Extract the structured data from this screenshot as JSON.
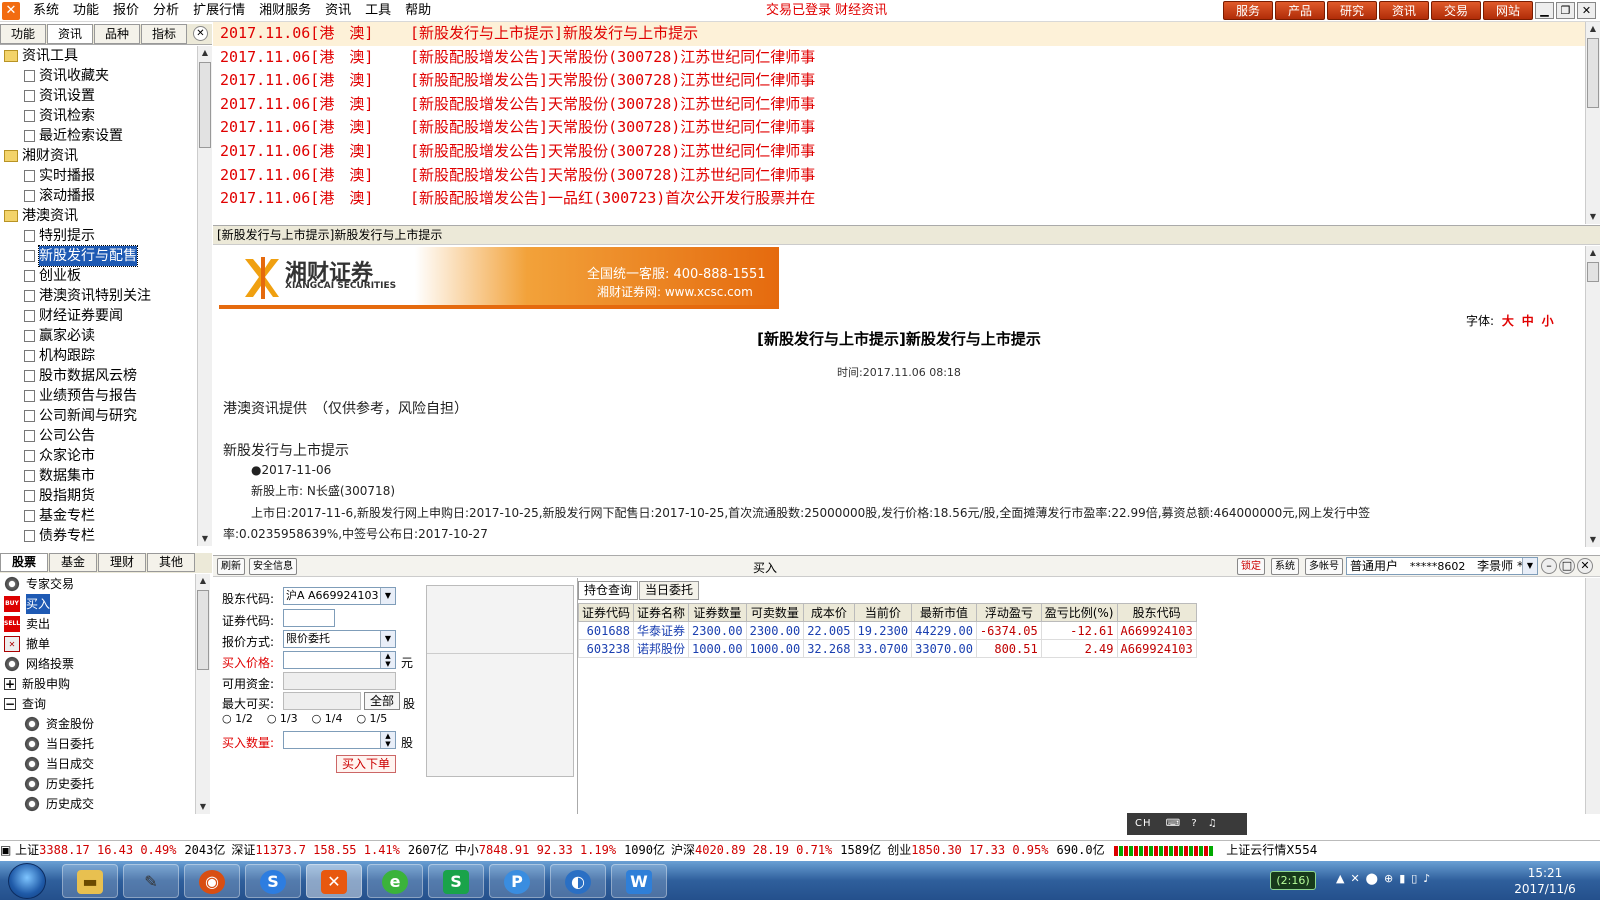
{
  "menubar": {
    "items": [
      "系统",
      "功能",
      "报价",
      "分析",
      "扩展行情",
      "湘财服务",
      "资讯",
      "工具",
      "帮助"
    ],
    "status": "交易已登录 财经资讯",
    "right_buttons": [
      "服务",
      "产品",
      "研究",
      "资讯",
      "交易",
      "网站"
    ]
  },
  "left_panel": {
    "tabs": [
      "功能",
      "资讯",
      "品种",
      "指标"
    ],
    "tree": [
      {
        "label": "资讯工具",
        "level": 1,
        "type": "folder"
      },
      {
        "label": "资讯收藏夹",
        "level": 2,
        "type": "doc"
      },
      {
        "label": "资讯设置",
        "level": 2,
        "type": "doc"
      },
      {
        "label": "资讯检索",
        "level": 2,
        "type": "doc"
      },
      {
        "label": "最近检索设置",
        "level": 2,
        "type": "doc"
      },
      {
        "label": "湘财资讯",
        "level": 1,
        "type": "folder"
      },
      {
        "label": "实时播报",
        "level": 2,
        "type": "doc"
      },
      {
        "label": "滚动播报",
        "level": 2,
        "type": "doc"
      },
      {
        "label": "港澳资讯",
        "level": 1,
        "type": "folder"
      },
      {
        "label": "特别提示",
        "level": 2,
        "type": "doc"
      },
      {
        "label": "新股发行与配售",
        "level": 2,
        "type": "doc",
        "selected": true
      },
      {
        "label": "创业板",
        "level": 2,
        "type": "doc"
      },
      {
        "label": "港澳资讯特别关注",
        "level": 2,
        "type": "doc"
      },
      {
        "label": "财经证券要闻",
        "level": 2,
        "type": "doc"
      },
      {
        "label": "赢家必读",
        "level": 2,
        "type": "doc"
      },
      {
        "label": "机构跟踪",
        "level": 2,
        "type": "doc"
      },
      {
        "label": "股市数据风云榜",
        "level": 2,
        "type": "doc"
      },
      {
        "label": "业绩预告与报告",
        "level": 2,
        "type": "doc"
      },
      {
        "label": "公司新闻与研究",
        "level": 2,
        "type": "doc"
      },
      {
        "label": "公司公告",
        "level": 2,
        "type": "doc"
      },
      {
        "label": "众家论市",
        "level": 2,
        "type": "doc"
      },
      {
        "label": "数据集市",
        "level": 2,
        "type": "doc"
      },
      {
        "label": "股指期货",
        "level": 2,
        "type": "doc"
      },
      {
        "label": "基金专栏",
        "level": 2,
        "type": "doc"
      },
      {
        "label": "债券专栏",
        "level": 2,
        "type": "doc"
      }
    ]
  },
  "news": [
    {
      "date": "2017.11.06[港　澳]",
      "title": "[新股发行与上市提示]新股发行与上市提示"
    },
    {
      "date": "2017.11.06[港　澳]",
      "title": "[新股配股增发公告]天常股份(300728)江苏世纪同仁律师事"
    },
    {
      "date": "2017.11.06[港　澳]",
      "title": "[新股配股增发公告]天常股份(300728)江苏世纪同仁律师事"
    },
    {
      "date": "2017.11.06[港　澳]",
      "title": "[新股配股增发公告]天常股份(300728)江苏世纪同仁律师事"
    },
    {
      "date": "2017.11.06[港　澳]",
      "title": "[新股配股增发公告]天常股份(300728)江苏世纪同仁律师事"
    },
    {
      "date": "2017.11.06[港　澳]",
      "title": "[新股配股增发公告]天常股份(300728)江苏世纪同仁律师事"
    },
    {
      "date": "2017.11.06[港　澳]",
      "title": "[新股配股增发公告]天常股份(300728)江苏世纪同仁律师事"
    },
    {
      "date": "2017.11.06[港　澳]",
      "title": "[新股配股增发公告]一品红(300723)首次公开发行股票并在"
    }
  ],
  "article": {
    "bar_title": "[新股发行与上市提示]新股发行与上市提示",
    "banner_brand": "湘财证券",
    "banner_brand_en": "XIANGCAI SECURITIES",
    "banner_hotline": "全国统一客服: 400-888-1551",
    "banner_site": "湘财证券网: www.xcsc.com",
    "font_label": "字体:",
    "font_sizes": [
      "大",
      "中",
      "小"
    ],
    "title": "[新股发行与上市提示]新股发行与上市提示",
    "time": "时间:2017.11.06 08:18",
    "source": "港澳资讯提供　（仅供参考，风险自担）",
    "heading": "新股发行与上市提示",
    "date_line": "●2017-11-06",
    "listing": "新股上市: N长盛(300718)",
    "detail1": "上市日:2017-11-6,新股发行网上申购日:2017-10-25,新股发行网下配售日:2017-10-25,首次流通股数:25000000股,发行价格:18.56元/股,全面摊薄发行市盈率:22.99倍,募资总额:464000000元,网上发行中签",
    "detail2": "率:0.0235958639%,中签号公布日:2017-10-27"
  },
  "trade": {
    "bottom_tabs": [
      "股票",
      "基金",
      "理财",
      "其他"
    ],
    "tree": [
      {
        "label": "专家交易",
        "level": 1,
        "icon": "gear"
      },
      {
        "label": "买入",
        "level": 1,
        "icon": "buy",
        "selected": true
      },
      {
        "label": "卖出",
        "level": 1,
        "icon": "sell"
      },
      {
        "label": "撤单",
        "level": 1,
        "icon": "cancel"
      },
      {
        "label": "网络投票",
        "level": 1,
        "icon": "gear"
      },
      {
        "label": "新股申购",
        "level": 1,
        "icon": "plus"
      },
      {
        "label": "查询",
        "level": 1,
        "icon": "minus"
      },
      {
        "label": "资金股份",
        "level": 2,
        "icon": "gear"
      },
      {
        "label": "当日委托",
        "level": 2,
        "icon": "gear"
      },
      {
        "label": "当日成交",
        "level": 2,
        "icon": "gear"
      },
      {
        "label": "历史委托",
        "level": 2,
        "icon": "gear"
      },
      {
        "label": "历史成交",
        "level": 2,
        "icon": "gear"
      }
    ],
    "toolbar_left": [
      "刷新",
      "安全信息"
    ],
    "title": "买入",
    "toolbar_right": [
      "锁定",
      "系统",
      "多帐号"
    ],
    "account_type": "普通用户",
    "account_no": "*****8602",
    "account_name": "李景师 ***",
    "form": {
      "holder_label": "股东代码:",
      "holder_value": "沪A A669924103",
      "code_label": "证券代码:",
      "price_mode_label": "报价方式:",
      "price_mode_value": "限价委托",
      "price_label": "买入价格:",
      "price_unit": "元",
      "funds_label": "可用资金:",
      "max_label": "最大可买:",
      "all_button": "全部",
      "max_unit": "股",
      "fractions": [
        "1/2",
        "1/3",
        "1/4",
        "1/5"
      ],
      "qty_label": "买入数量:",
      "qty_unit": "股",
      "submit": "买入下单"
    },
    "holdings_tabs": [
      "持仓查询",
      "当日委托"
    ],
    "holdings_columns": [
      "证券代码",
      "证券名称",
      "证券数量",
      "可卖数量",
      "成本价",
      "当前价",
      "最新市值",
      "浮动盈亏",
      "盈亏比例(%)",
      "股东代码"
    ],
    "holdings_rows": [
      [
        "601688",
        "华泰证券",
        "2300.00",
        "2300.00",
        "22.005",
        "19.2300",
        "44229.00",
        "-6374.05",
        "-12.61",
        "A669924103"
      ],
      [
        "603238",
        "诺邦股份",
        "1000.00",
        "1000.00",
        "32.268",
        "33.0700",
        "33070.00",
        "800.51",
        "2.49",
        "A669924103"
      ]
    ]
  },
  "ime": {
    "label": "CH"
  },
  "ticker": [
    {
      "name": "上证",
      "value": "3388.17",
      "change": "16.43",
      "pct": "0.49%",
      "vol": "2043亿"
    },
    {
      "name": "深证",
      "value": "11373.7",
      "change": "158.55",
      "pct": "1.41%",
      "vol": "2607亿"
    },
    {
      "name": "中小",
      "value": "7848.91",
      "change": "92.33",
      "pct": "1.19%",
      "vol": "1090亿"
    },
    {
      "name": "沪深",
      "value": "4020.89",
      "change": "28.19",
      "pct": "0.71%",
      "vol": "1589亿"
    },
    {
      "name": "创业",
      "value": "1850.30",
      "change": "17.33",
      "pct": "0.95%",
      "vol": "690.0亿"
    }
  ],
  "ticker_source": "上证云行情X554",
  "taskbar": {
    "battery": "(2:16)",
    "time": "15:21",
    "date": "2017/11/6"
  },
  "colors": {
    "news_red": "#e00000",
    "accent": "#e56a0e",
    "select": "#1e5ab4"
  }
}
